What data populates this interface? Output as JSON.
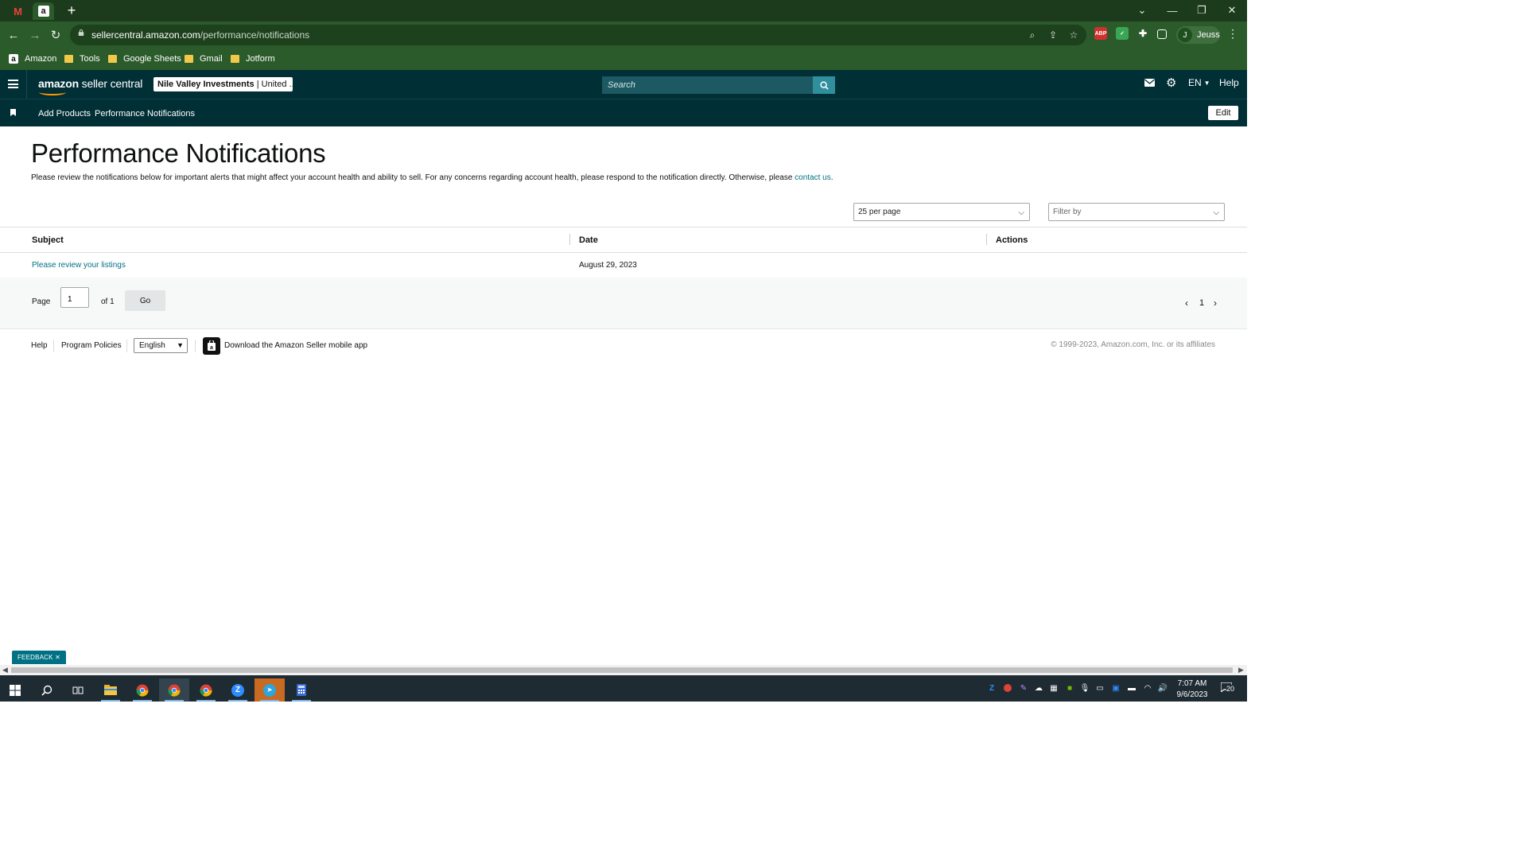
{
  "browser": {
    "url_host": "sellercentral.amazon.com",
    "url_path": "/performance/notifications",
    "profile_initial": "J",
    "profile_name": "Jeuss",
    "bookmarks": [
      "Amazon",
      "Tools",
      "Google Sheets",
      "Gmail",
      "Jotform"
    ],
    "ext_abp": "ABP"
  },
  "header": {
    "logo_brand": "amazon",
    "logo_product": "seller central",
    "account_name": "Nile Valley Investments",
    "account_region": "United ...",
    "search_placeholder": "Search",
    "language": "EN",
    "help": "Help"
  },
  "subnav": {
    "items": [
      "Add Products",
      "Performance Notifications"
    ],
    "edit": "Edit"
  },
  "page": {
    "title": "Performance Notifications",
    "intro": "Please review the notifications below for important alerts that might affect your account health and ability to sell. For any concerns regarding account health, please respond to the notification directly. Otherwise, please ",
    "intro_link": "contact us",
    "intro_end": ".",
    "per_page": "25 per page",
    "filter": "Filter by"
  },
  "table": {
    "columns": [
      "Subject",
      "Date",
      "Actions"
    ],
    "rows": [
      {
        "subject": "Please review your listings",
        "date": "August 29, 2023",
        "actions": ""
      }
    ]
  },
  "pager": {
    "page_label": "Page",
    "current": "1",
    "of_label": "of 1",
    "go": "Go",
    "page_number": "1"
  },
  "footer": {
    "help": "Help",
    "policies": "Program Policies",
    "language": "English",
    "app_link": "Download the Amazon Seller mobile app",
    "copyright": "© 1999-2023, Amazon.com, Inc. or its affiliates"
  },
  "feedback": "FEEDBACK",
  "taskbar": {
    "time": "7:07 AM",
    "date": "9/6/2023",
    "notifications": "20"
  },
  "colors": {
    "header_bg": "#002f36",
    "link": "#007185",
    "browser_green": "#2b5a2b"
  }
}
